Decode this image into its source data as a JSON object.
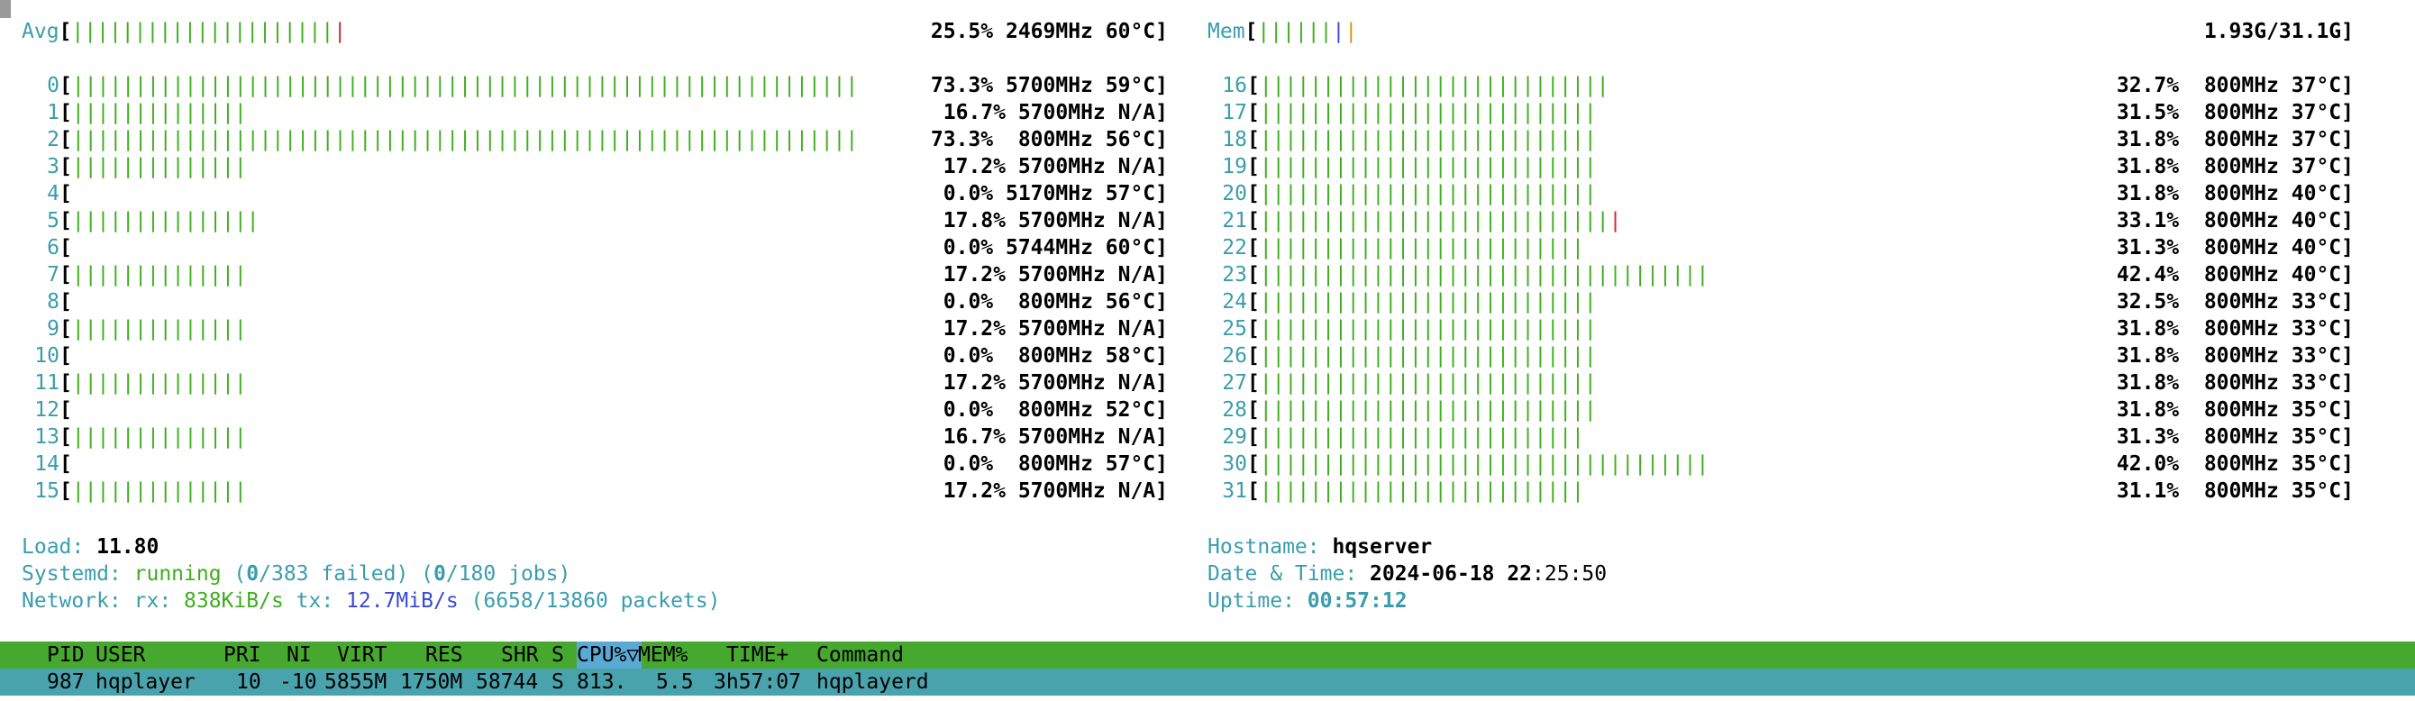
{
  "avg": {
    "label": "Avg",
    "bar_green": "|||||||||||||||||||||",
    "bar_red": "|",
    "stats": "25.5% 2469MHz 60°C]"
  },
  "mem": {
    "label": "Mem",
    "bar_green": "||||||",
    "bar_blue": "|",
    "bar_yellow": "|",
    "stats": "1.93G/31.1G]"
  },
  "cpus_left": [
    {
      "id": "0",
      "bar": "|||||||||||||||||||||||||||||||||||||||||||||||||||||||||||||||",
      "stats": "73.3% 5700MHz 59°C]"
    },
    {
      "id": "1",
      "bar": "||||||||||||||",
      "stats": "16.7% 5700MHz N/A]"
    },
    {
      "id": "2",
      "bar": "|||||||||||||||||||||||||||||||||||||||||||||||||||||||||||||||",
      "stats": "73.3%  800MHz 56°C]"
    },
    {
      "id": "3",
      "bar": "||||||||||||||",
      "stats": "17.2% 5700MHz N/A]"
    },
    {
      "id": "4",
      "bar": "",
      "stats": "0.0% 5170MHz 57°C]"
    },
    {
      "id": "5",
      "bar": "|||||||||||||||",
      "stats": "17.8% 5700MHz N/A]"
    },
    {
      "id": "6",
      "bar": "",
      "stats": "0.0% 5744MHz 60°C]"
    },
    {
      "id": "7",
      "bar": "||||||||||||||",
      "stats": "17.2% 5700MHz N/A]"
    },
    {
      "id": "8",
      "bar": "",
      "stats": "0.0%  800MHz 56°C]"
    },
    {
      "id": "9",
      "bar": "||||||||||||||",
      "stats": "17.2% 5700MHz N/A]"
    },
    {
      "id": "10",
      "bar": "",
      "stats": "0.0%  800MHz 58°C]"
    },
    {
      "id": "11",
      "bar": "||||||||||||||",
      "stats": "17.2% 5700MHz N/A]"
    },
    {
      "id": "12",
      "bar": "",
      "stats": "0.0%  800MHz 52°C]"
    },
    {
      "id": "13",
      "bar": "||||||||||||||",
      "stats": "16.7% 5700MHz N/A]"
    },
    {
      "id": "14",
      "bar": "",
      "stats": "0.0%  800MHz 57°C]"
    },
    {
      "id": "15",
      "bar": "||||||||||||||",
      "stats": "17.2% 5700MHz N/A]"
    }
  ],
  "cpus_right": [
    {
      "id": "16",
      "bar": "||||||||||||||||||||||||||||",
      "red": "",
      "stats": "32.7%  800MHz 37°C]"
    },
    {
      "id": "17",
      "bar": "|||||||||||||||||||||||||||",
      "red": "",
      "stats": "31.5%  800MHz 37°C]"
    },
    {
      "id": "18",
      "bar": "|||||||||||||||||||||||||||",
      "red": "",
      "stats": "31.8%  800MHz 37°C]"
    },
    {
      "id": "19",
      "bar": "|||||||||||||||||||||||||||",
      "red": "",
      "stats": "31.8%  800MHz 37°C]"
    },
    {
      "id": "20",
      "bar": "|||||||||||||||||||||||||||",
      "red": "",
      "stats": "31.8%  800MHz 40°C]"
    },
    {
      "id": "21",
      "bar": "||||||||||||||||||||||||||||",
      "red": "|",
      "stats": "33.1%  800MHz 40°C]"
    },
    {
      "id": "22",
      "bar": "||||||||||||||||||||||||||",
      "red": "",
      "stats": "31.3%  800MHz 40°C]"
    },
    {
      "id": "23",
      "bar": "||||||||||||||||||||||||||||||||||||",
      "red": "",
      "stats": "42.4%  800MHz 40°C]"
    },
    {
      "id": "24",
      "bar": "|||||||||||||||||||||||||||",
      "red": "",
      "stats": "32.5%  800MHz 33°C]"
    },
    {
      "id": "25",
      "bar": "|||||||||||||||||||||||||||",
      "red": "",
      "stats": "31.8%  800MHz 33°C]"
    },
    {
      "id": "26",
      "bar": "|||||||||||||||||||||||||||",
      "red": "",
      "stats": "31.8%  800MHz 33°C]"
    },
    {
      "id": "27",
      "bar": "|||||||||||||||||||||||||||",
      "red": "",
      "stats": "31.8%  800MHz 33°C]"
    },
    {
      "id": "28",
      "bar": "|||||||||||||||||||||||||||",
      "red": "",
      "stats": "31.8%  800MHz 35°C]"
    },
    {
      "id": "29",
      "bar": "||||||||||||||||||||||||||",
      "red": "",
      "stats": "31.3%  800MHz 35°C]"
    },
    {
      "id": "30",
      "bar": "||||||||||||||||||||||||||||||||||||",
      "red": "",
      "stats": "42.0%  800MHz 35°C]"
    },
    {
      "id": "31",
      "bar": "||||||||||||||||||||||||||",
      "red": "",
      "stats": "31.1%  800MHz 35°C]"
    }
  ],
  "load": {
    "label": "Load: ",
    "value": "11.80"
  },
  "systemd": {
    "label": "Systemd: ",
    "state": "running",
    "open1": " (",
    "failed_count": "0",
    "failed_total": "/383",
    "failed_word": " failed) (",
    "jobs_count": "0",
    "jobs_total": "/180",
    "jobs_word": " jobs)"
  },
  "network": {
    "label": "Network: ",
    "rx_label": "rx: ",
    "rx": "838KiB/s",
    "tx_label": " tx: ",
    "tx": "12.7MiB/s",
    "packets": " (6658/13860 packets)"
  },
  "hostname": {
    "label": "Hostname: ",
    "value": "hqserver"
  },
  "datetime": {
    "label": "Date & Time: ",
    "date": "2024-06-18 22",
    "time": ":25:50"
  },
  "uptime": {
    "label": "Uptime: ",
    "value": "00:57:12"
  },
  "table": {
    "headers": {
      "pid": "PID",
      "user": "USER",
      "pri": "PRI",
      "ni": "NI",
      "virt": "VIRT",
      "res": "RES",
      "shr": "SHR",
      "s": "S",
      "cpu": "CPU%▽",
      "mem": "MEM%",
      "time": "TIME+",
      "command": "Command"
    },
    "row": {
      "pid": "987",
      "user": "hqplayer",
      "pri": "10",
      "ni": "-10",
      "virt": "5855M",
      "res": "1750M",
      "shr": "58744",
      "s": "S",
      "cpu": "813.",
      "mem": "5.5",
      "time": "3h57:07",
      "command": "hqplayerd"
    }
  },
  "colors": {
    "green": "#3fae1e",
    "cyan": "#3a9dad",
    "red": "#d0242b",
    "header_bg": "#46a82f",
    "row_bg": "#49a3ad"
  }
}
